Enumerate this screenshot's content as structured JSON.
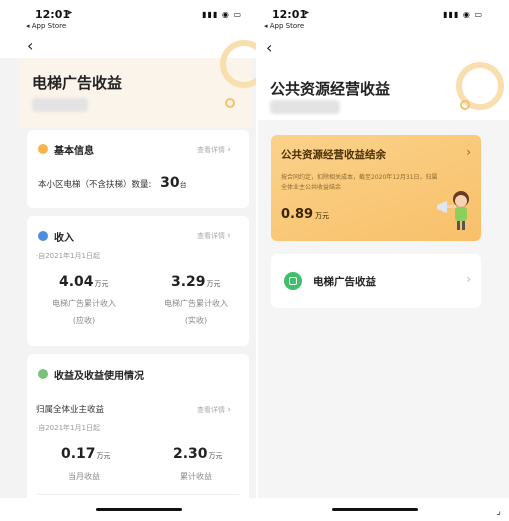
{
  "left": {
    "status": {
      "time": "12:01",
      "app_store": "◂ App Store"
    },
    "title": "电梯广告收益",
    "basic": {
      "title": "基本信息",
      "link": "查看详情",
      "elevator_label": "本小区电梯（不含扶梯）数量:",
      "elevator_count": "30",
      "elevator_unit": "台"
    },
    "income": {
      "title": "收入",
      "link": "查看详情",
      "since": "·自2021年1月1日起",
      "receivable": {
        "value": "4.04",
        "unit": "万元",
        "label": "电梯广告累计收入",
        "sub": "(应收)"
      },
      "received": {
        "value": "3.29",
        "unit": "万元",
        "label": "电梯广告累计收入",
        "sub": "(实收)"
      }
    },
    "usage": {
      "title": "收益及收益使用情况",
      "owner_label": "归属全体业主收益",
      "link": "查看详情",
      "since": "·自2021年1月1日起",
      "monthly": {
        "value": "0.17",
        "unit": "万元",
        "label": "当月收益"
      },
      "cumulative": {
        "value": "2.30",
        "unit": "万元",
        "label": "累计收益"
      }
    }
  },
  "right": {
    "status": {
      "time": "12:01",
      "app_store": "◂ App Store"
    },
    "title": "公共资源经营收益",
    "balance": {
      "title": "公共资源经营收益结余",
      "desc_line1": "按合同约定，扣除相关成本，截至2020年12月31日，归属",
      "desc_line2": "全体业主公共收益结余",
      "value": "0.89",
      "unit": "万元"
    },
    "elevator_item": {
      "label": "电梯广告收益"
    }
  },
  "icons": {
    "back": "chevron-left-icon",
    "more": "chevron-right-icon",
    "signal": "signal-icon",
    "wifi": "wifi-icon",
    "battery": "battery-icon",
    "location": "location-arrow-icon"
  },
  "colors": {
    "accent_orange": "#f8c06a",
    "hero_bg": "#fbf4ea",
    "green": "#3fbf6a",
    "blue": "#4a8fe0",
    "orange_dot": "#f5a623",
    "green_dot": "#79c27a"
  }
}
